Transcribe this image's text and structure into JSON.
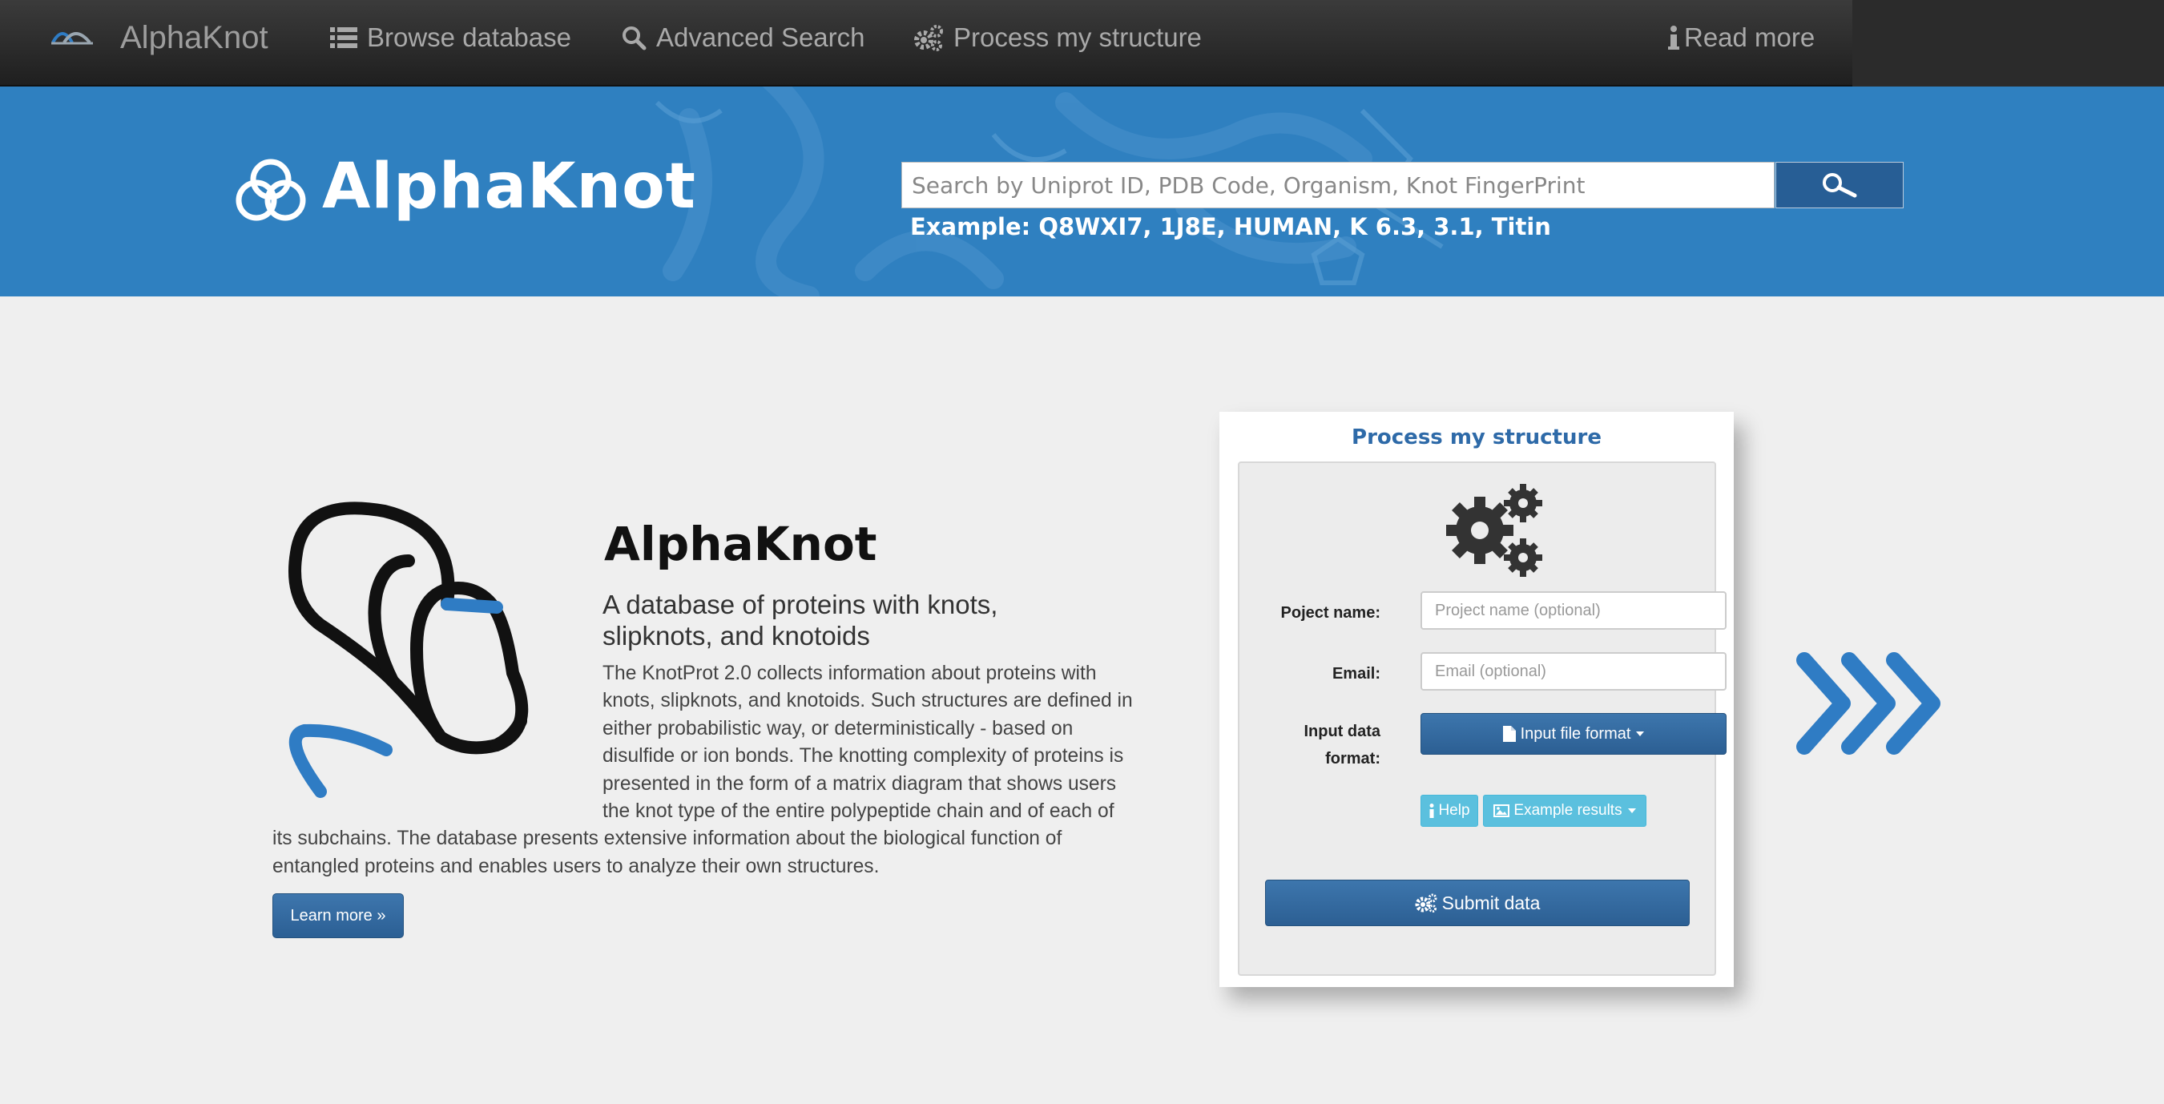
{
  "navbar": {
    "brand": "AlphaKnot",
    "items": [
      {
        "label": "Browse database",
        "icon": "list-icon"
      },
      {
        "label": "Advanced Search",
        "icon": "search-icon"
      },
      {
        "label": "Process my structure",
        "icon": "cogs-icon"
      }
    ],
    "read_more": "Read more"
  },
  "hero": {
    "title": "AlphaKnot",
    "search_placeholder": "Search by Uniprot ID, PDB Code, Organism, Knot FingerPrint",
    "search_example": "Example: Q8WXI7, 1J8E, HUMAN, K 6.3, 3.1, Titin"
  },
  "intro": {
    "title": "AlphaKnot",
    "subtitle": "A database of proteins with knots, slipknots, and knotoids",
    "paragraph": "The KnotProt 2.0 collects information about proteins with knots, slipknots, and knotoids. Such structures are defined in either probabilistic way, or deterministically - based on disulfide or ion bonds. The knotting complexity of proteins is presented in the form of a matrix diagram that shows users the knot type of the entire polypeptide chain and of each of its subchains. The database presents extensive information about the biological function of entangled proteins and enables users to analyze their own structures.",
    "learn_more": "Learn more »"
  },
  "process_panel": {
    "title": "Process my structure",
    "project_label": "Poject name:",
    "project_placeholder": "Project name (optional)",
    "email_label": "Email:",
    "email_placeholder": "Email (optional)",
    "format_label": "Input data format:",
    "format_button": "Input file format",
    "help_button": "Help",
    "example_button": "Example results",
    "submit_button": "Submit data"
  },
  "colors": {
    "navbar": "#2a2a2a",
    "hero_blue": "#2f80c0",
    "accent_blue": "#2e6aa8",
    "info_button": "#5bc0de",
    "chevron_blue": "#2f7cc4"
  }
}
